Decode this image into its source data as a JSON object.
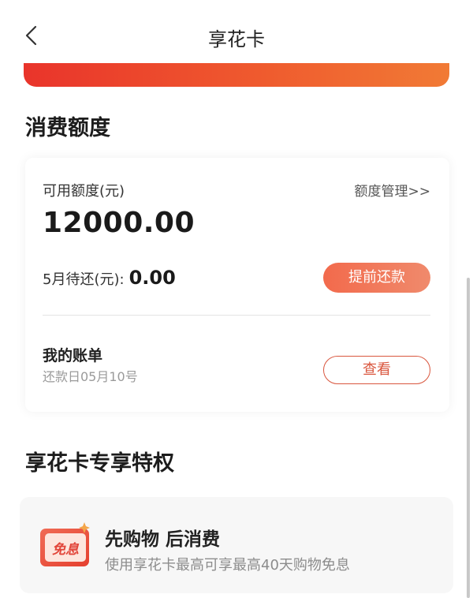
{
  "header": {
    "title": "享花卡",
    "back_icon": "chevron-left-icon"
  },
  "quota": {
    "section_title": "消费额度",
    "available_label": "可用额度(元)",
    "manage_link": "额度管理>>",
    "amount": "12000.00",
    "due_label": "5月待还(元):",
    "due_value": "0.00",
    "prepay_button": "提前还款"
  },
  "bill": {
    "title": "我的账单",
    "due_date": "还款日05月10号",
    "view_button": "查看"
  },
  "privileges": {
    "section_title": "享花卡专享特权",
    "items": [
      {
        "icon": "interest-free-card-icon",
        "icon_text": "免息",
        "title": "先购物 后消费",
        "desc": "使用享花卡最高可享最高40天购物免息"
      }
    ]
  },
  "colors": {
    "accent": "#e9342b",
    "button_gradient_start": "#f26a4c",
    "outline_button": "#d9563e"
  }
}
